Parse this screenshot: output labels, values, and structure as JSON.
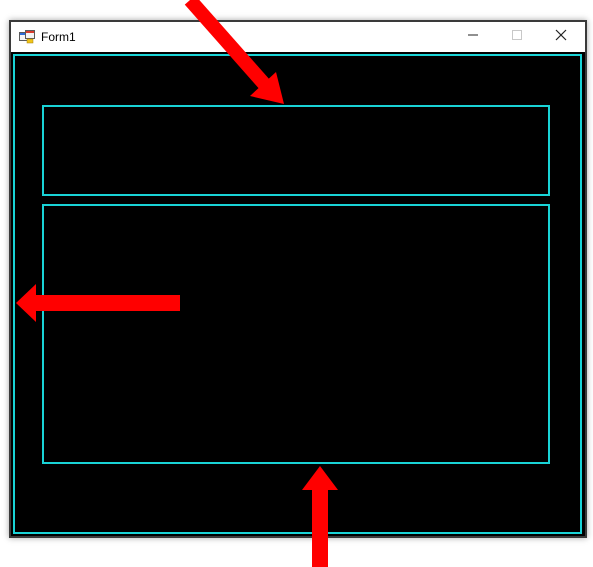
{
  "window": {
    "title": "Form1"
  },
  "icons": {
    "app": "form-app-icon",
    "minimize": "minimize-icon",
    "maximize": "maximize-icon",
    "close": "close-icon",
    "arrow_down": "arrow-down-icon",
    "arrow_left": "arrow-left-icon",
    "arrow_up": "arrow-up-icon"
  },
  "colors": {
    "panel_border": "#19d3d6",
    "background": "#000000",
    "annotation_arrow": "#ff0000"
  }
}
